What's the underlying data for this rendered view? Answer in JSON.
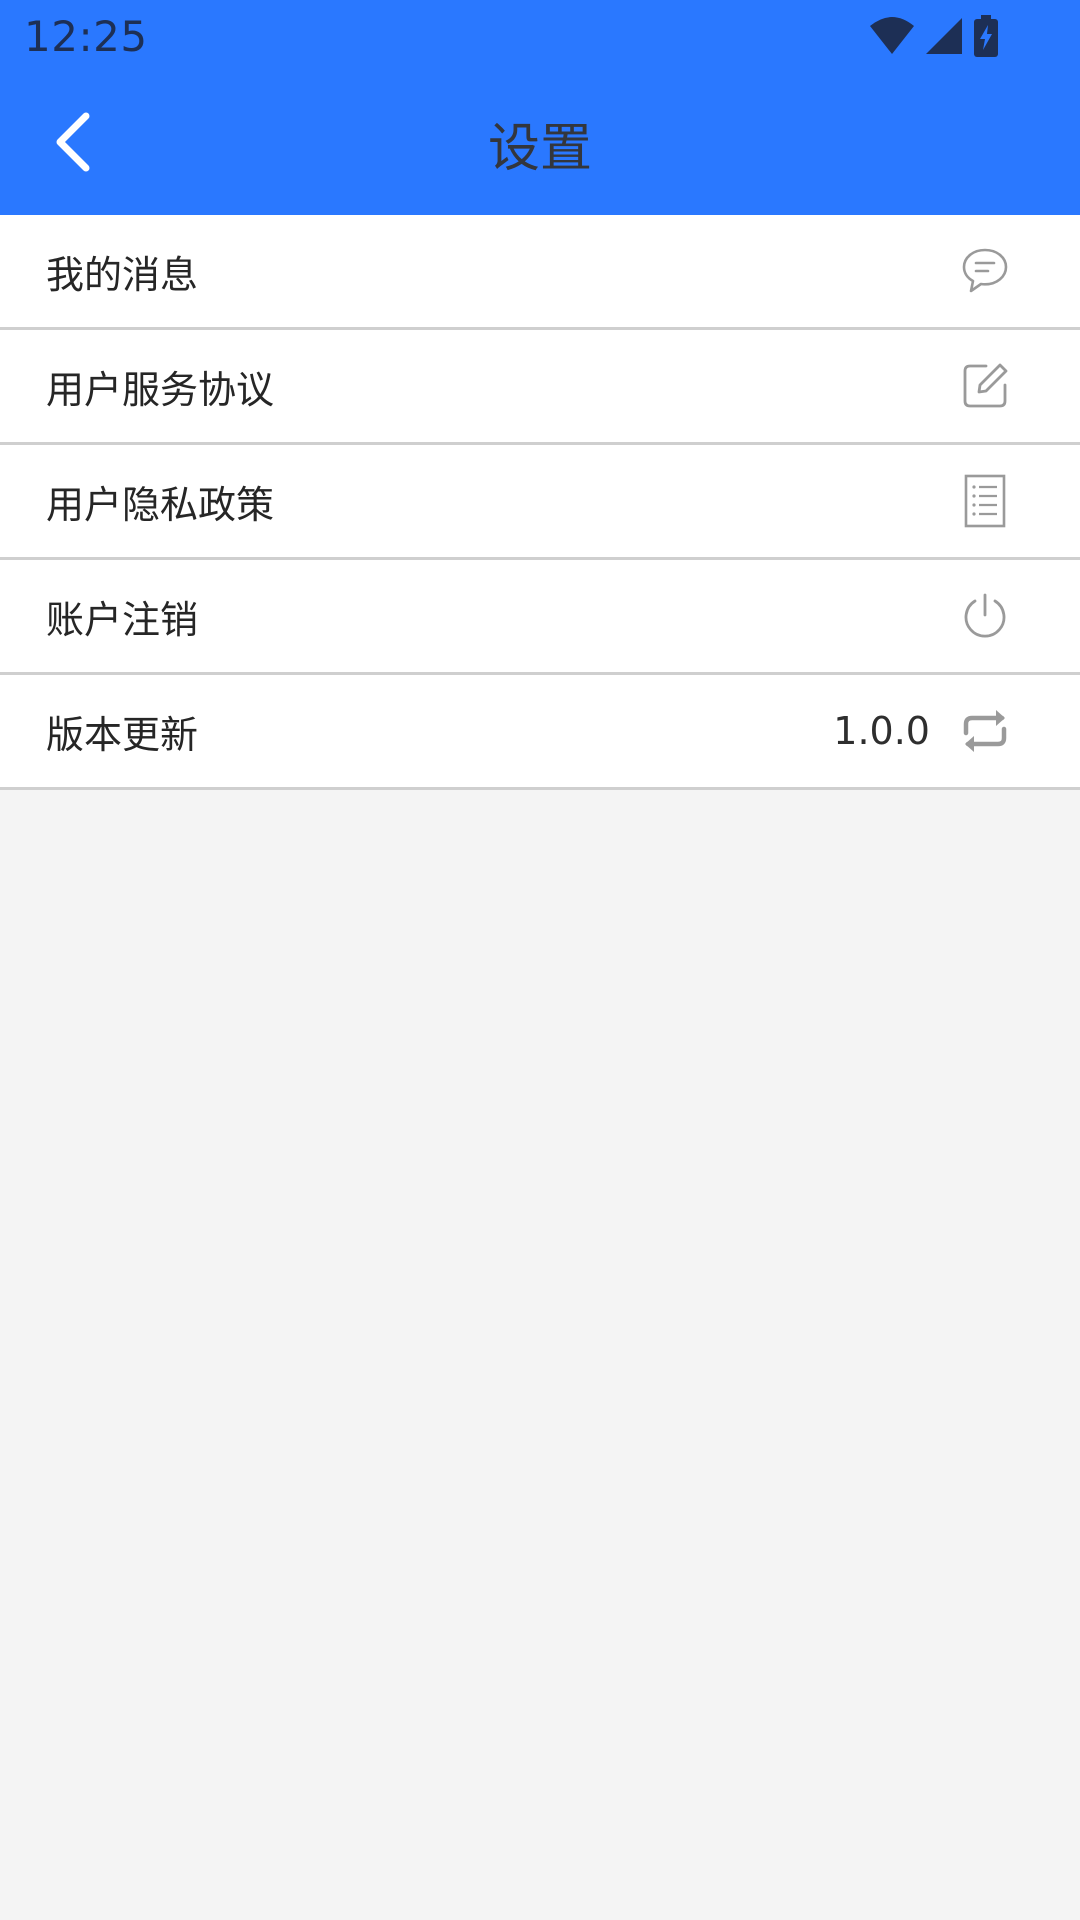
{
  "status_bar": {
    "time": "12:25",
    "icons": [
      "wifi-icon",
      "cell-signal-icon",
      "battery-charging-icon"
    ]
  },
  "app_bar": {
    "title": "设置",
    "back_icon": "chevron-left-icon"
  },
  "colors": {
    "app_bar_bg": "#2a78ff",
    "page_bg": "#f4f4f4",
    "icon_gray": "#9a9a9a"
  },
  "settings": {
    "items": [
      {
        "label": "我的消息",
        "icon": "chat-bubble-icon"
      },
      {
        "label": "用户服务协议",
        "icon": "edit-icon"
      },
      {
        "label": "用户隐私政策",
        "icon": "document-list-icon"
      },
      {
        "label": "账户注销",
        "icon": "power-icon"
      },
      {
        "label": "版本更新",
        "value": "1.0.0",
        "icon": "refresh-icon"
      }
    ]
  }
}
